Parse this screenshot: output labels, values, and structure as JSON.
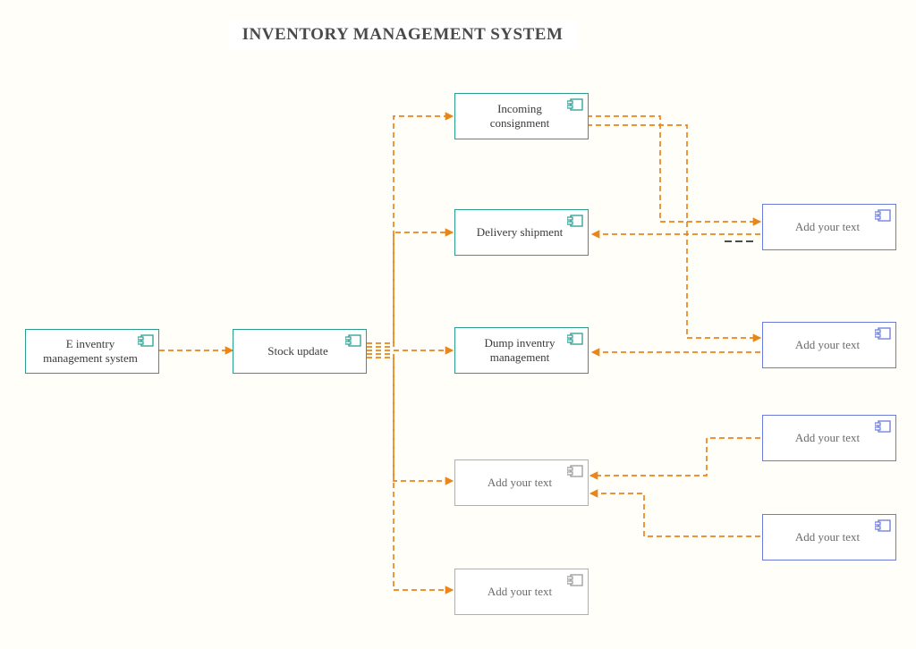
{
  "title": "INVENTORY MANAGEMENT SYSTEM",
  "nodes": {
    "n1": {
      "label": "E inventry management system"
    },
    "n2": {
      "label": "Stock update"
    },
    "n3": {
      "label": "Incoming consignment"
    },
    "n4": {
      "label": "Delivery shipment"
    },
    "n5": {
      "label": "Dump inventry management"
    },
    "n6": {
      "label": "Add your text"
    },
    "n7": {
      "label": "Add your text"
    },
    "r1": {
      "label": "Add your text"
    },
    "r2": {
      "label": "Add your text"
    },
    "r3": {
      "label": "Add your text"
    },
    "r4": {
      "label": "Add your text"
    }
  },
  "palette": {
    "orange": "#e8851b",
    "teal": "#2a9d8f",
    "grey": "#b0b0b0",
    "blue": "#6a7bd9"
  },
  "diagram_type": "UML component diagram"
}
